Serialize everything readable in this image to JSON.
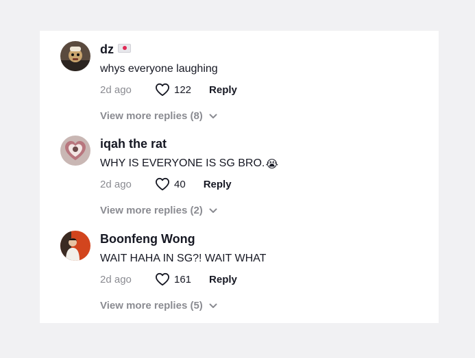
{
  "comments": [
    {
      "username": "dz",
      "has_flag": true,
      "text": "whys everyone laughing",
      "emoji": "",
      "time": "2d ago",
      "likes": "122",
      "reply_label": "Reply",
      "view_more": "View more replies (8)"
    },
    {
      "username": "iqah the rat",
      "has_flag": false,
      "text": "WHY IS EVERYONE IS SG BRO.",
      "emoji": "😭",
      "time": "2d ago",
      "likes": "40",
      "reply_label": "Reply",
      "view_more": "View more replies (2)"
    },
    {
      "username": "Boonfeng Wong",
      "has_flag": false,
      "text": "WAIT HAHA IN SG?! WAIT WHAT",
      "emoji": "",
      "time": "2d ago",
      "likes": "161",
      "reply_label": "Reply",
      "view_more": "View more replies (5)"
    }
  ],
  "icons": {
    "like": "heart-outline-icon",
    "expand": "chevron-down-icon"
  }
}
